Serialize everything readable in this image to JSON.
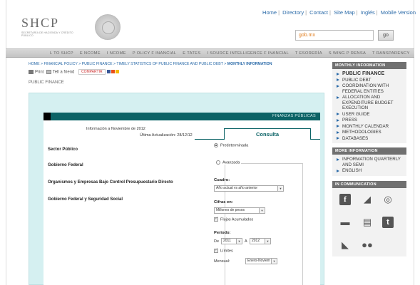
{
  "header": {
    "toplinks": [
      "Home",
      "Directory",
      "Contact",
      "Site Map",
      "Inglés",
      "Mobile Version"
    ],
    "logo_text": "SHCP",
    "logo_subtext": "SECRETARÍA DE HACIENDA Y CRÉDITO PÚBLICO",
    "search_value": "gob.mx",
    "search_button": "go"
  },
  "mainnav": [
    "L TO SHCP",
    "E NCOME",
    "I NCOME",
    "P OLICY F INANCIAL",
    "E TATES",
    "I SOURCE INTELLIGENCE F INANCIAL",
    "T ESORERÍA",
    "S WING P RENSA",
    "T RANSPARENCY"
  ],
  "breadcrumb": {
    "path": "HOME > FINANCIAL POLICY > PUBLIC FINANCE > TIMELY STATISTICS OF PUBLIC FINANCE AND PUBLIC DEBT > ",
    "current": "MONTHLY INFORMATION"
  },
  "share": {
    "print": "Print",
    "tell": "Tell a friend",
    "compartir": "COMPARTIR"
  },
  "section_label": "PUBLIC FINANCE",
  "panel": {
    "header_title": "FINANZAS PÚBLICAS",
    "info_line1": "Información a Noviembre de 2012",
    "info_line2": "Última Actualización: 28/12/12",
    "rows": [
      "Sector Público",
      "Gobierno Federal",
      "Organismos y Empresas Bajo Control Presupuestario Directo",
      "Gobierno Federal y Seguridad Social"
    ]
  },
  "consulta": {
    "tab_label": "Consulta",
    "radio_predeterminada": "Predeterminada",
    "radio_avanzada": "Avanzada",
    "cuadro_label": "Cuadro:",
    "cuadro_value": "Año actual vs año anterior",
    "cifras_label": "Cifras en:",
    "cifras_value": "Millones de pesos",
    "flujos_label": "Flujos Acumulados",
    "periodo_label": "Periodo:",
    "de_label": "De",
    "de_value": "2011",
    "a_label": "A",
    "a_value": "2012",
    "limites_label": "Límites",
    "mensual_label": "Mensual:",
    "mensual_value": "Enero-Noviem"
  },
  "sidebar": {
    "monthly_head": "MONTHLY INFORMATION",
    "monthly_items": [
      "PUBLIC FINANCE",
      "PUBLIC DEBT",
      "COORDINATION WITH FEDERAL ENTITIES",
      "ALLOCATION AND EXPENDITURE BUDGET EXECUTION",
      "USER GUIDE",
      "PRESS",
      "MONTHLY CALENDAR",
      "METHODOLOGIES",
      "DATABASES"
    ],
    "more_head": "MORE INFORMATION",
    "more_items": [
      "INFORMATION QUARTERLY AND SEMI",
      "ENGLISH"
    ],
    "comm_head": "IN COMMUNICATION",
    "comm_icons": [
      "facebook-icon",
      "megaphone-icon",
      "podcast-icon",
      "rss-icon",
      "document-icon",
      "twitter-icon",
      "announcement-icon",
      "chat-icon"
    ]
  }
}
